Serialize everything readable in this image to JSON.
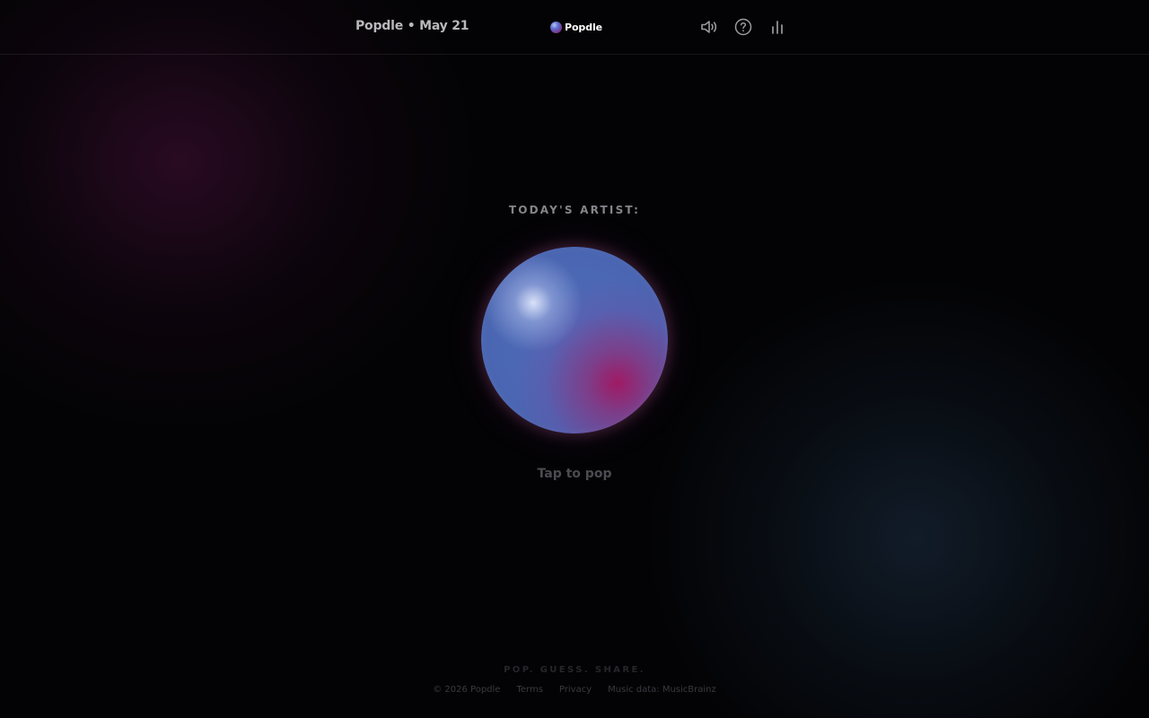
{
  "header": {
    "date_title": "Popdle • May 21",
    "brand_name": "Popdle",
    "icons": {
      "sound": "speaker-icon",
      "help": "help-circle-icon",
      "stats": "bar-chart-icon"
    }
  },
  "main": {
    "label": "TODAY'S ARTIST:",
    "tap_hint": "Tap to pop"
  },
  "footer": {
    "tagline": "POP. GUESS. SHARE.",
    "copyright": "© 2026 Popdle",
    "terms": "Terms",
    "privacy": "Privacy",
    "music_data": "Music data: MusicBrainz"
  },
  "colors": {
    "background": "#030305",
    "bubble_blue": "#4b67b3",
    "bubble_magenta": "#a4165f",
    "text_muted": "#85848b"
  }
}
